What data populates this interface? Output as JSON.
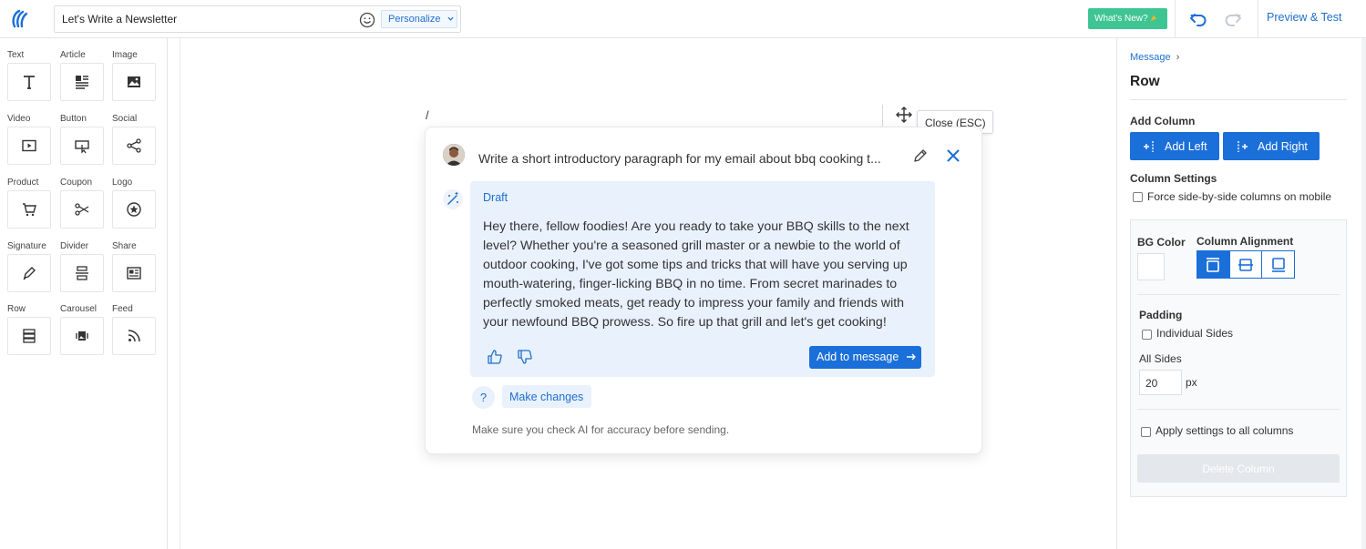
{
  "header": {
    "subject": "Let's Write a Newsletter",
    "personalize_label": "Personalize",
    "whats_new_label": "What's New?",
    "preview_label": "Preview & Test"
  },
  "tools": [
    {
      "label": "Text",
      "icon": "text-icon"
    },
    {
      "label": "Article",
      "icon": "article-icon"
    },
    {
      "label": "Image",
      "icon": "image-icon"
    },
    {
      "label": "Video",
      "icon": "video-icon"
    },
    {
      "label": "Button",
      "icon": "button-icon"
    },
    {
      "label": "Social",
      "icon": "share-nodes-icon"
    },
    {
      "label": "Product",
      "icon": "cart-icon"
    },
    {
      "label": "Coupon",
      "icon": "scissors-icon"
    },
    {
      "label": "Logo",
      "icon": "star-circle-icon"
    },
    {
      "label": "Signature",
      "icon": "pen-icon"
    },
    {
      "label": "Divider",
      "icon": "divider-icon"
    },
    {
      "label": "Share",
      "icon": "share-card-icon"
    },
    {
      "label": "Row",
      "icon": "rows-icon"
    },
    {
      "label": "Carousel",
      "icon": "carousel-icon"
    },
    {
      "label": "Feed",
      "icon": "rss-icon"
    }
  ],
  "canvas": {
    "slash": "/",
    "tooltip": "Close (ESC)"
  },
  "ai": {
    "prompt": "Write a short introductory paragraph for my email about bbq cooking t...",
    "draft_title": "Draft",
    "draft_body": "Hey there, fellow foodies! Are you ready to take your BBQ skills to the next level? Whether you're a seasoned grill master or a newbie to the world of outdoor cooking, I've got some tips and tricks that will have you serving up mouth-watering, finger-licking BBQ in no time. From secret marinades to perfectly smoked meats, get ready to impress your family and friends with your newfound BBQ prowess. So fire up that grill and let's get cooking!",
    "add_to_message_label": "Add to message",
    "help_label": "?",
    "make_changes_label": "Make changes",
    "disclaimer": "Make sure you check AI for accuracy before sending."
  },
  "panel": {
    "breadcrumb": "Message",
    "title": "Row",
    "add_column_heading": "Add Column",
    "add_left_label": "Add Left",
    "add_right_label": "Add Right",
    "column_settings_heading": "Column Settings",
    "force_side_label": "Force side-by-side columns on mobile",
    "bg_color_label": "BG Color",
    "column_alignment_label": "Column Alignment",
    "padding_heading": "Padding",
    "individual_sides_label": "Individual Sides",
    "all_sides_label": "All Sides",
    "all_sides_value": "20",
    "unit": "px",
    "apply_all_label": "Apply settings to all columns",
    "delete_column_label": "Delete Column"
  },
  "colors": {
    "accent": "#1a6fd9",
    "whats_new": "#3fc593",
    "draft_bg": "#e9f1fd"
  }
}
